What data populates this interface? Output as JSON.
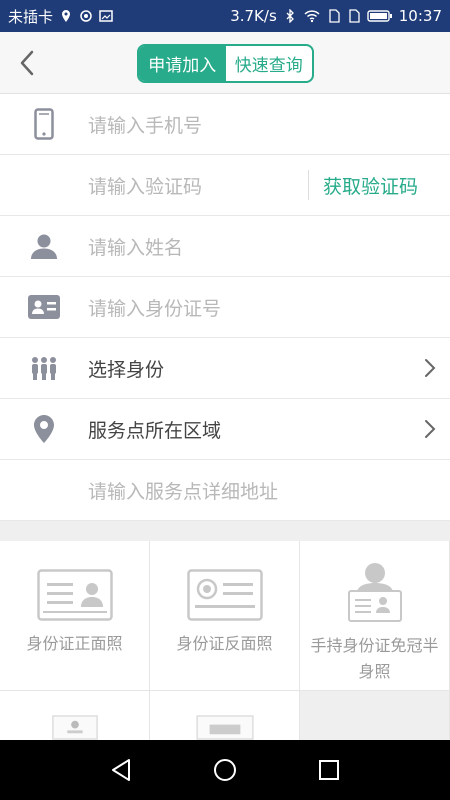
{
  "status_bar": {
    "carrier": "未插卡",
    "speed": "3.7K/s",
    "time": "10:37"
  },
  "nav": {
    "tabs": [
      {
        "label": "申请加入",
        "active": true
      },
      {
        "label": "快速查询",
        "active": false
      }
    ]
  },
  "form": {
    "phone_placeholder": "请输入手机号",
    "code_placeholder": "请输入验证码",
    "get_code_label": "获取验证码",
    "name_placeholder": "请输入姓名",
    "idcard_placeholder": "请输入身份证号",
    "identity_label": "选择身份",
    "region_label": "服务点所在区域",
    "address_placeholder": "请输入服务点详细地址"
  },
  "photos": [
    {
      "label": "身份证正面照"
    },
    {
      "label": "身份证反面照"
    },
    {
      "label": "手持身份证免冠半身照"
    }
  ],
  "colors": {
    "accent": "#27ab8a",
    "status_bar": "#1f3b78",
    "icon_gray": "#8c8f9c"
  }
}
